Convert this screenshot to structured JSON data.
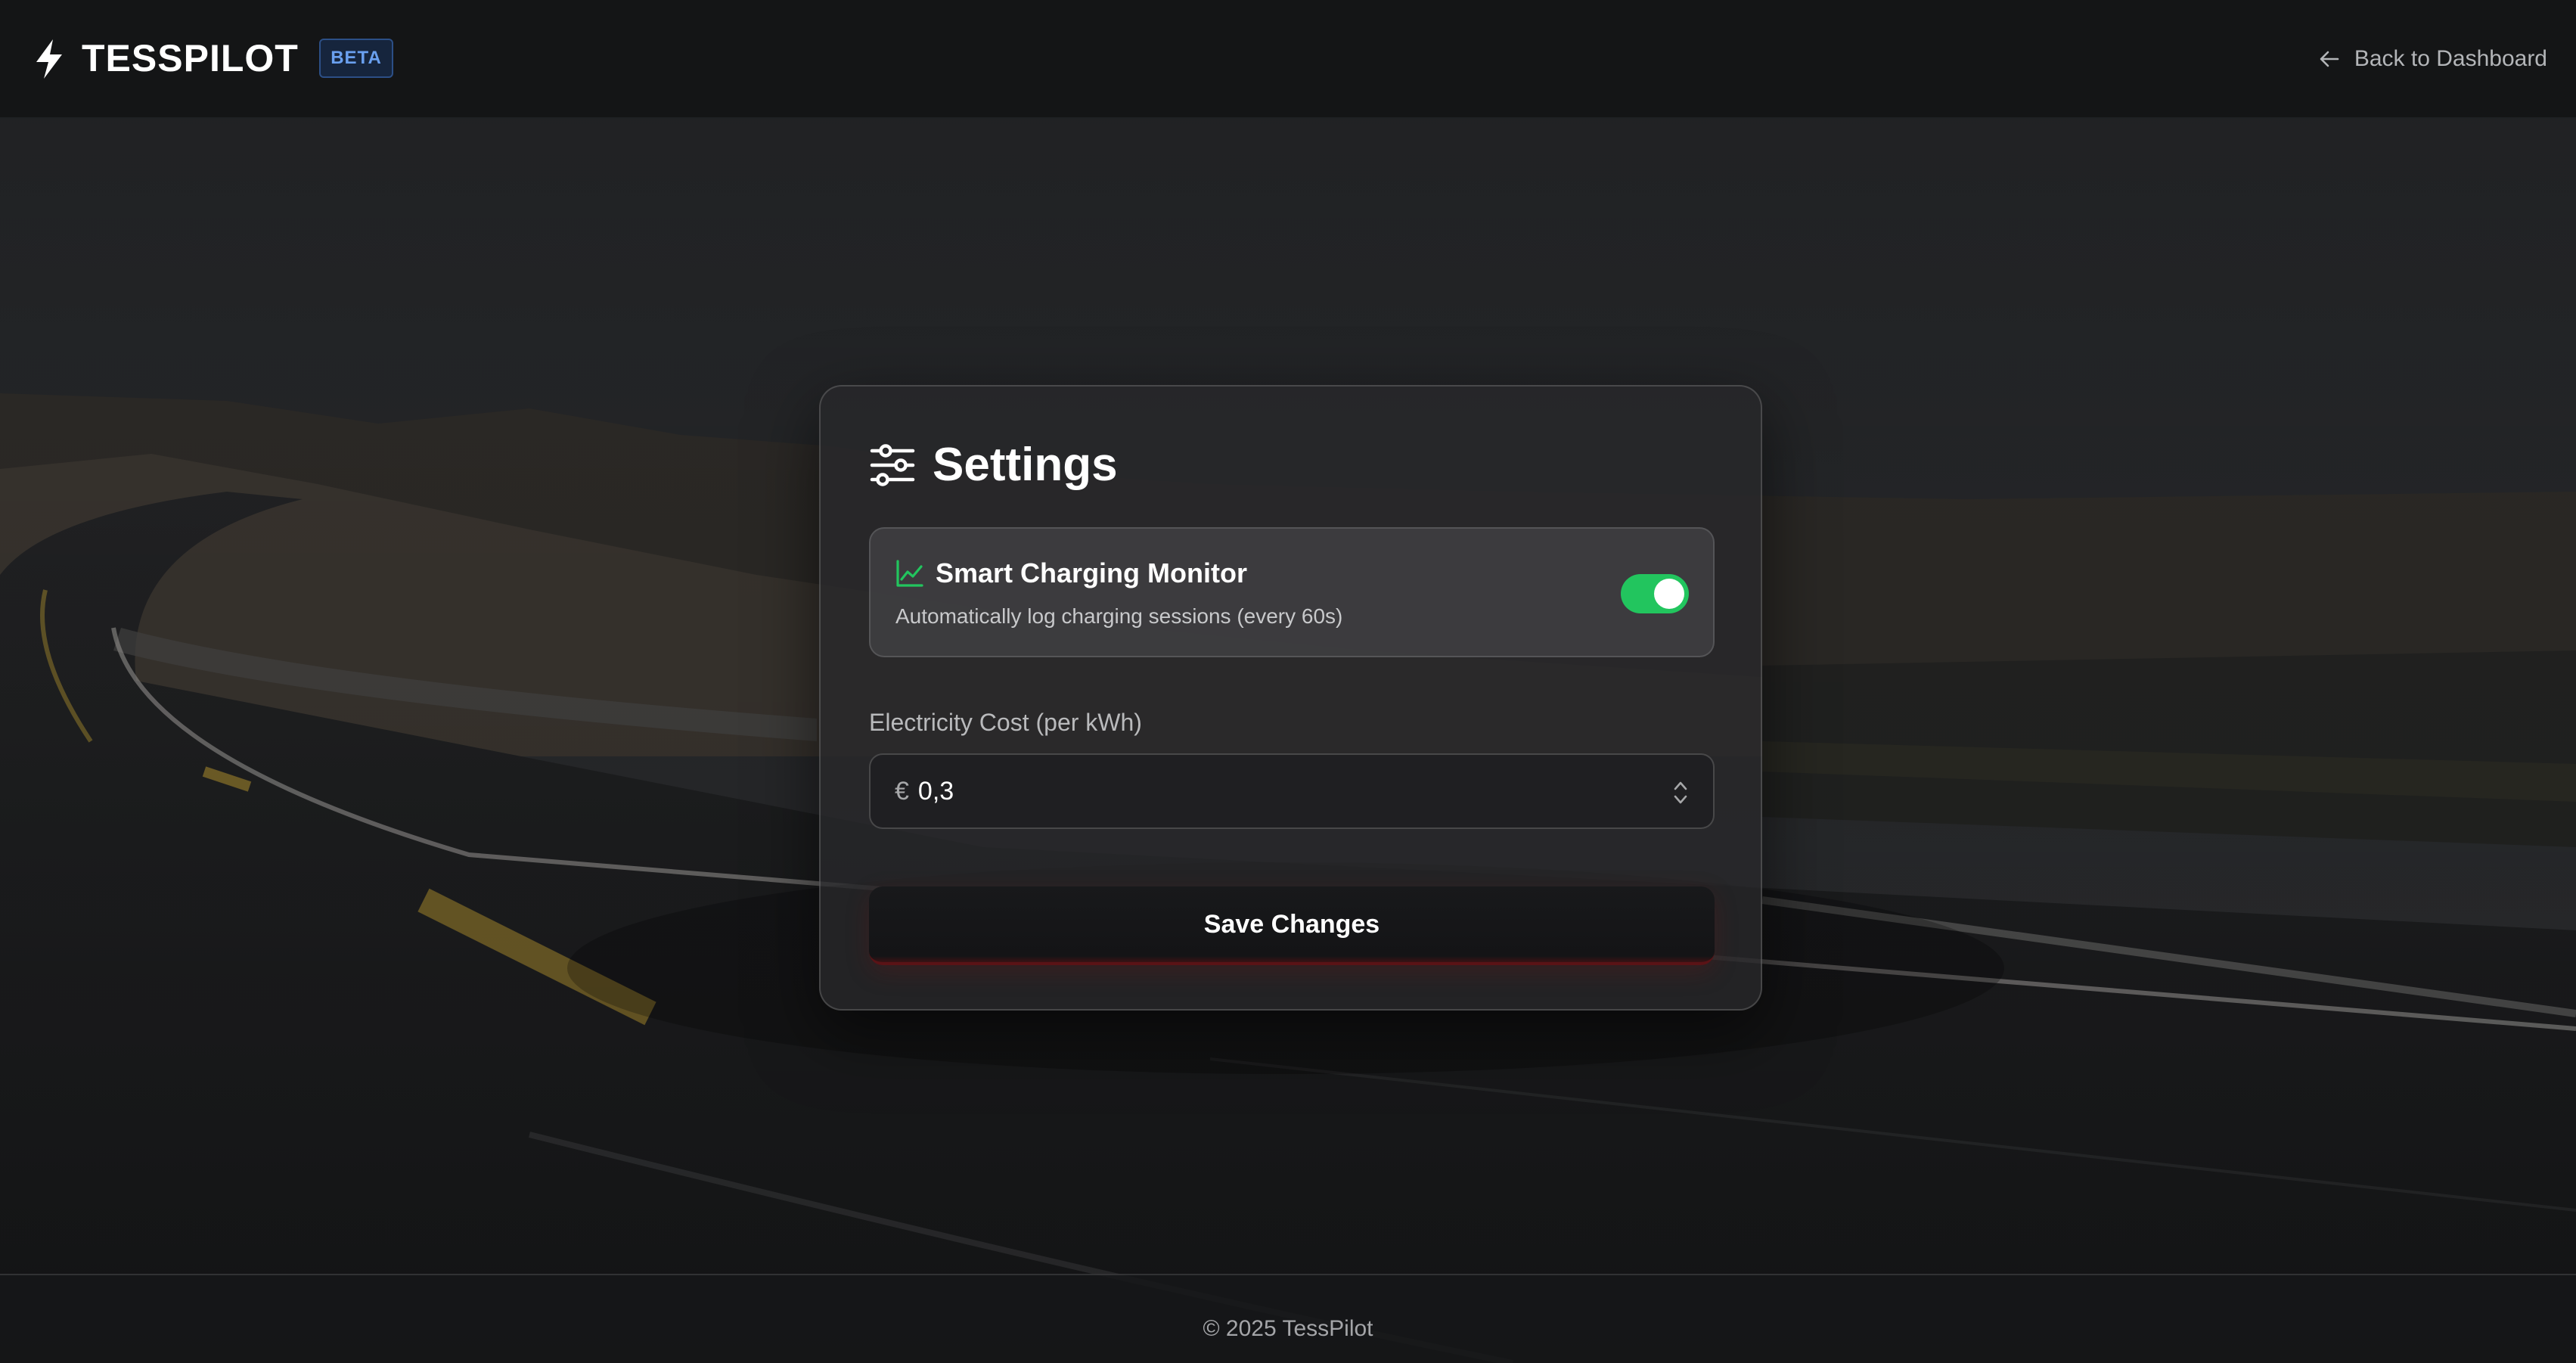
{
  "app": {
    "name": "TESSPILOT",
    "badge": "BETA",
    "back_link_label": "Back to Dashboard"
  },
  "settings": {
    "title": "Settings",
    "smart_charging": {
      "title": "Smart Charging Monitor",
      "description": "Automatically log charging sessions (every 60s)",
      "enabled": true
    },
    "electricity_cost": {
      "label": "Electricity Cost (per kWh)",
      "currency_symbol": "€",
      "value": "0,3"
    },
    "save_label": "Save Changes"
  },
  "footer": {
    "copyright": "© 2025 TessPilot"
  },
  "colors": {
    "accent_green": "#22c55e",
    "beta_blue": "#6aa0ef",
    "save_glow_red": "#5a1316"
  }
}
